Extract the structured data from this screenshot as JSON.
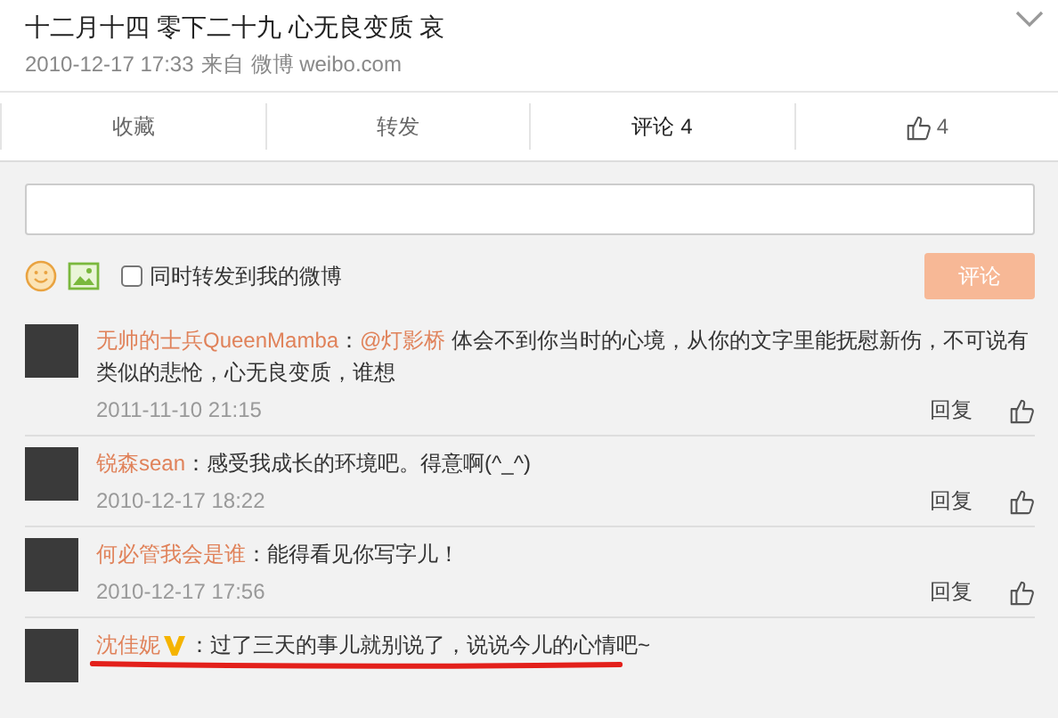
{
  "post": {
    "title": "十二月十四 零下二十九 心无良变质 哀",
    "time": "2010-12-17 17:33",
    "source_label": "来自",
    "source": "微博 weibo.com"
  },
  "tabs": [
    {
      "label": "收藏",
      "selected": false,
      "kind": "text"
    },
    {
      "label": "转发",
      "selected": false,
      "kind": "text"
    },
    {
      "label": "评论 4",
      "selected": true,
      "kind": "text"
    },
    {
      "label": "4",
      "selected": false,
      "kind": "like"
    }
  ],
  "composer": {
    "repost_label": "同时转发到我的微博",
    "repost_checked": false,
    "submit": "评论",
    "submit_disabled": true
  },
  "comments": [
    {
      "name": "无帅的士兵QueenMamba",
      "verified": false,
      "sep": "：",
      "mention": "@灯影桥",
      "text": " 体会不到你当时的心境，从你的文字里能抚慰新伤，不可说有类似的悲怆，心无良变质，谁想",
      "time": "2011-11-10 21:15",
      "reply": "回复",
      "underlined": false
    },
    {
      "name": "锐森sean",
      "verified": false,
      "sep": "：",
      "text": "感受我成长的环境吧。得意啊(^_^)",
      "time": "2010-12-17 18:22",
      "reply": "回复",
      "underlined": false
    },
    {
      "name": "何必管我会是谁",
      "verified": false,
      "sep": "：",
      "text": "能得看见你写字儿！",
      "time": "2010-12-17 17:56",
      "reply": "回复",
      "underlined": false
    },
    {
      "name": "沈佳妮",
      "verified": true,
      "sep": "：",
      "text": "过了三天的事儿就别说了，说说今儿的心情吧~",
      "underlined": true
    }
  ]
}
